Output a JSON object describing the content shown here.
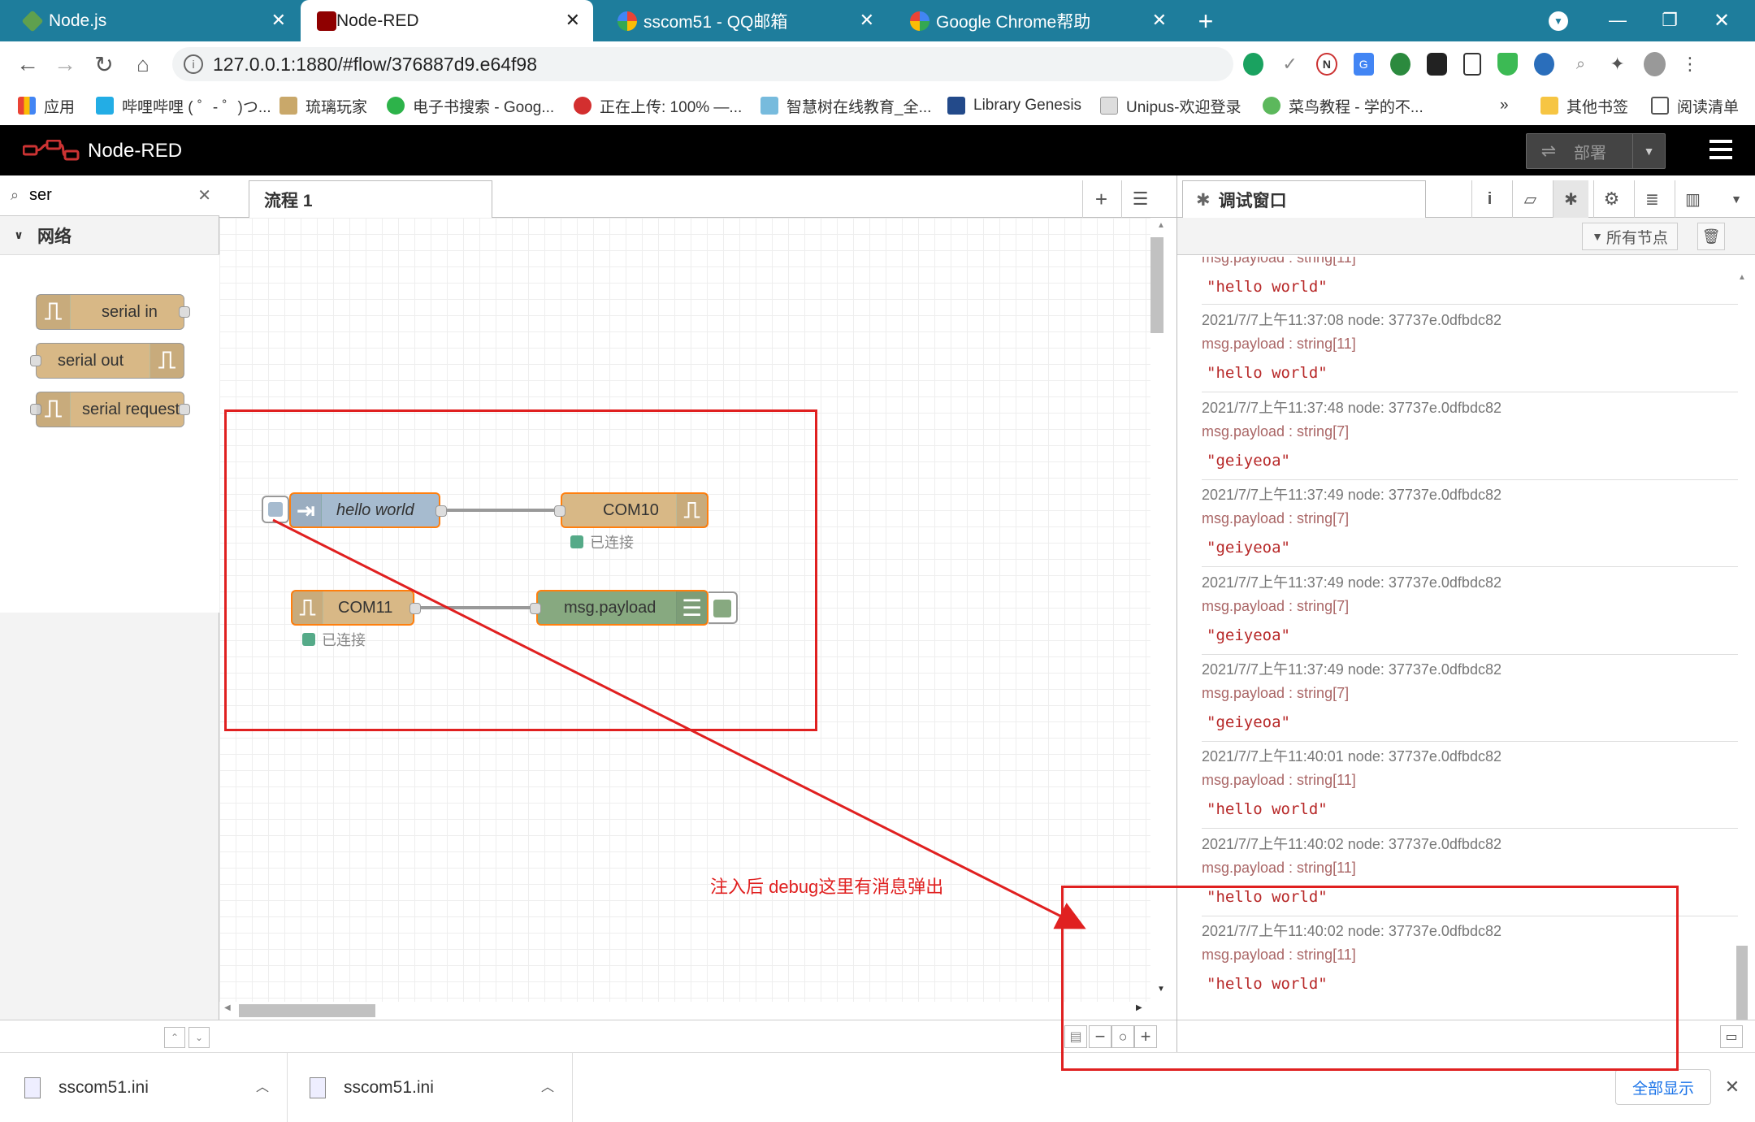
{
  "browser": {
    "tabs": [
      {
        "title": "Node.js",
        "icon": "nodejs-favicon-icon",
        "color": "#5fa04e"
      },
      {
        "title": "Node-RED",
        "icon": "node-red-favicon-icon",
        "color": "#8f0000"
      },
      {
        "title": "sscom51 - QQ邮箱",
        "icon": "qqmail-favicon-icon",
        "color": "#1a73e8"
      },
      {
        "title": "Google Chrome帮助",
        "icon": "google-favicon-icon",
        "color": "#4285f4"
      }
    ],
    "new_tab": "+",
    "url": "127.0.0.1:1880/#flow/376887d9.e64f98",
    "bookmarks": [
      {
        "label": "应用",
        "icon": "apps-grid-icon"
      },
      {
        "label": "哔哩哔哩 ( ゜- ゜)つ...",
        "icon": "bilibili-icon"
      },
      {
        "label": "琉璃玩家",
        "icon": "site-icon"
      },
      {
        "label": "电子书搜索 - Goog...",
        "icon": "ebook-icon"
      },
      {
        "label": "正在上传: 100% —...",
        "icon": "upload-icon"
      },
      {
        "label": "智慧树在线教育_全...",
        "icon": "zhihuishu-icon"
      },
      {
        "label": "Library Genesis",
        "icon": "libgen-icon"
      },
      {
        "label": "Unipus-欢迎登录",
        "icon": "unipus-icon"
      },
      {
        "label": "菜鸟教程 - 学的不...",
        "icon": "runoob-icon"
      }
    ],
    "bookmarks_more": "»",
    "other_bookmarks": "其他书签",
    "reading_list": "阅读清单"
  },
  "nodered": {
    "title": "Node-RED",
    "deploy_label": "部署",
    "palette": {
      "search_value": "ser",
      "category": "网络",
      "nodes": [
        "serial in",
        "serial out",
        "serial request"
      ]
    },
    "workspace": {
      "tab": "流程 1",
      "nodes": {
        "inject": "hello world",
        "com10": "COM10",
        "com10_status": "已连接",
        "com11": "COM11",
        "com11_status": "已连接",
        "debug": "msg.payload"
      }
    },
    "sidebar": {
      "title": "调试窗口",
      "filter_label": "所有节点",
      "messages": [
        {
          "meta": "",
          "type": "msg.payload : string[11]",
          "value": "\"hello world\""
        },
        {
          "meta": "2021/7/7上午11:37:08   node: 37737e.0dfbdc82",
          "type": "msg.payload : string[11]",
          "value": "\"hello world\""
        },
        {
          "meta": "2021/7/7上午11:37:48   node: 37737e.0dfbdc82",
          "type": "msg.payload : string[7]",
          "value": "\"geiyeoa\""
        },
        {
          "meta": "2021/7/7上午11:37:49   node: 37737e.0dfbdc82",
          "type": "msg.payload : string[7]",
          "value": "\"geiyeoa\""
        },
        {
          "meta": "2021/7/7上午11:37:49   node: 37737e.0dfbdc82",
          "type": "msg.payload : string[7]",
          "value": "\"geiyeoa\""
        },
        {
          "meta": "2021/7/7上午11:37:49   node: 37737e.0dfbdc82",
          "type": "msg.payload : string[7]",
          "value": "\"geiyeoa\""
        },
        {
          "meta": "2021/7/7上午11:40:01   node: 37737e.0dfbdc82",
          "type": "msg.payload : string[11]",
          "value": "\"hello world\""
        },
        {
          "meta": "2021/7/7上午11:40:02   node: 37737e.0dfbdc82",
          "type": "msg.payload : string[11]",
          "value": "\"hello world\""
        },
        {
          "meta": "2021/7/7上午11:40:02   node: 37737e.0dfbdc82",
          "type": "msg.payload : string[11]",
          "value": "\"hello world\""
        }
      ]
    }
  },
  "annotation": {
    "text": "注入后 debug这里有消息弹出",
    "color": "#e02020"
  },
  "downloads": {
    "files": [
      "sscom51.ini",
      "sscom51.ini"
    ],
    "show_all": "全部显示"
  }
}
